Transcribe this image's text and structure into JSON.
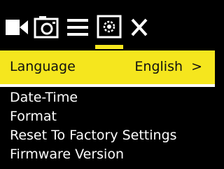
{
  "toolbar": {
    "icons": [
      "video-camera-icon",
      "photo-camera-icon",
      "menu-list-icon",
      "settings-gear-icon",
      "close-icon"
    ],
    "active_tab": "settings-gear-icon"
  },
  "menu": {
    "selected": {
      "label": "Language",
      "value": "English",
      "arrow": ">"
    },
    "items": [
      {
        "label": "Date-Time"
      },
      {
        "label": "Format"
      },
      {
        "label": "Reset To Factory Settings"
      },
      {
        "label": "Firmware Version"
      }
    ]
  },
  "colors": {
    "highlight": "#f5e61e",
    "background": "#000000",
    "text": "#ffffff"
  }
}
